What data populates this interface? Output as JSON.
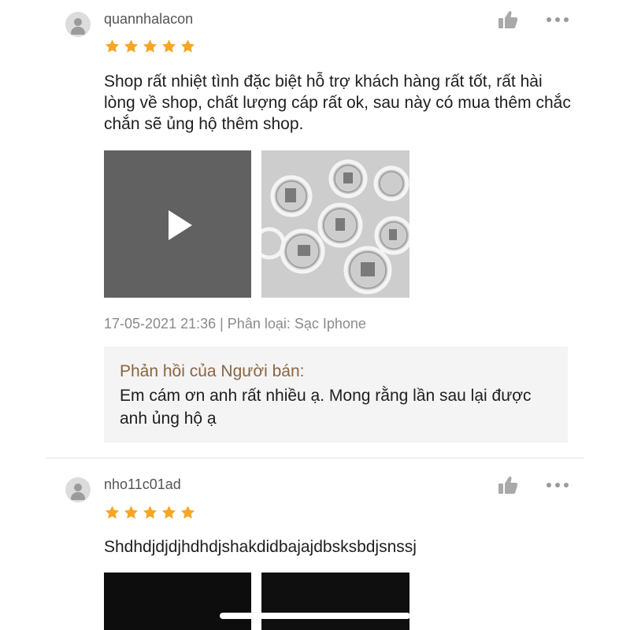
{
  "reviews": [
    {
      "username": "quannhalacon",
      "rating": 5,
      "comment": "Shop rất nhiệt tình đặc biệt hỗ trợ khách hàng rất tốt, rất hài lòng về shop, chất lượng cáp rất ok, sau này có mua thêm chắc chắn sẽ ủng hộ thêm shop.",
      "meta": "17-05-2021 21:36 | Phân loại: Sạc Iphone",
      "seller_reply": {
        "title": "Phản hồi của Người bán:",
        "text": "Em cám ơn anh rất nhiều ạ. Mong rằng lần sau lại được anh ủng hộ ạ"
      }
    },
    {
      "username": "nho11c01ad",
      "rating": 5,
      "comment": "Shdhdjdjdjhdhdjshakdidbajajdbsksbdjsnssj"
    }
  ],
  "icons": {
    "like": "thumbs-up-icon",
    "more": "more-dots-icon",
    "star": "star-icon",
    "play": "play-icon",
    "avatar": "user-avatar-icon"
  },
  "colors": {
    "star": "#f5a623",
    "seller_title": "#8a6540",
    "meta": "#8a8a8a",
    "seller_box_bg": "#f4f4f4"
  }
}
